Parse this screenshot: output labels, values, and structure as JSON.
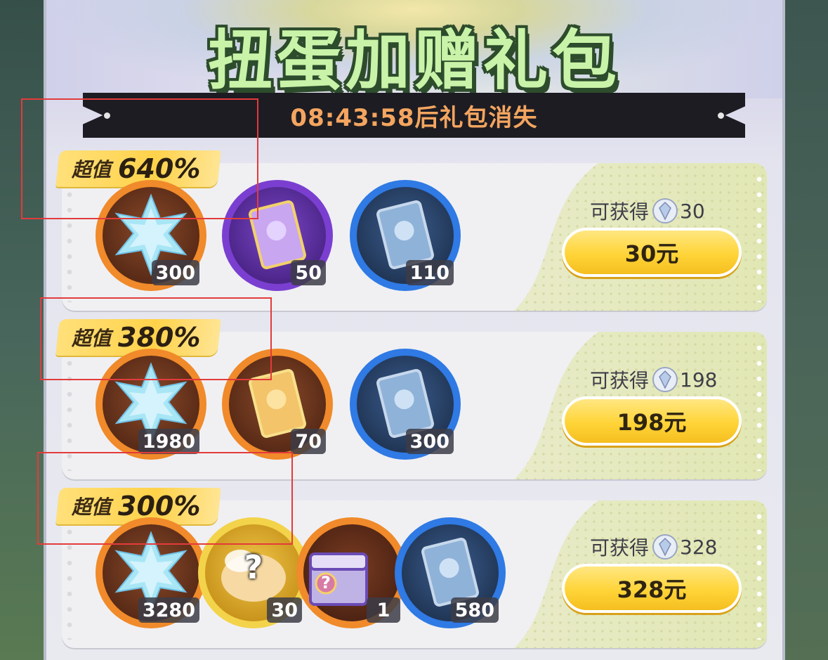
{
  "title": "扭蛋加赠礼包",
  "timer": {
    "text": "08:43:58后礼包消失"
  },
  "colors": {
    "accent": "#ffd437",
    "timer_text": "#f4a560",
    "title_fill": "#c9f3a8",
    "annotation": "#e33b3b"
  },
  "packages": [
    {
      "tag_label": "超值",
      "tag_value": "640%",
      "items": [
        {
          "icon": "star-crystal-icon",
          "count": "300"
        },
        {
          "icon": "purple-card-icon",
          "count": "50"
        },
        {
          "icon": "blue-card-icon",
          "count": "110"
        }
      ],
      "reward_label": "可获得",
      "reward_amount": "30",
      "price": "30元"
    },
    {
      "tag_label": "超值",
      "tag_value": "380%",
      "items": [
        {
          "icon": "star-crystal-icon",
          "count": "1980"
        },
        {
          "icon": "gold-card-icon",
          "count": "70"
        },
        {
          "icon": "blue-card-icon",
          "count": "300"
        }
      ],
      "reward_label": "可获得",
      "reward_amount": "198",
      "price": "198元"
    },
    {
      "tag_label": "超值",
      "tag_value": "300%",
      "items": [
        {
          "icon": "star-crystal-icon",
          "count": "3280"
        },
        {
          "icon": "mystery-pet-icon",
          "count": "30",
          "glyph": "?"
        },
        {
          "icon": "mystery-chest-icon",
          "count": "1",
          "glyph": "?"
        },
        {
          "icon": "blue-card-icon",
          "count": "580"
        }
      ],
      "reward_label": "可获得",
      "reward_amount": "328",
      "price": "328元"
    }
  ]
}
